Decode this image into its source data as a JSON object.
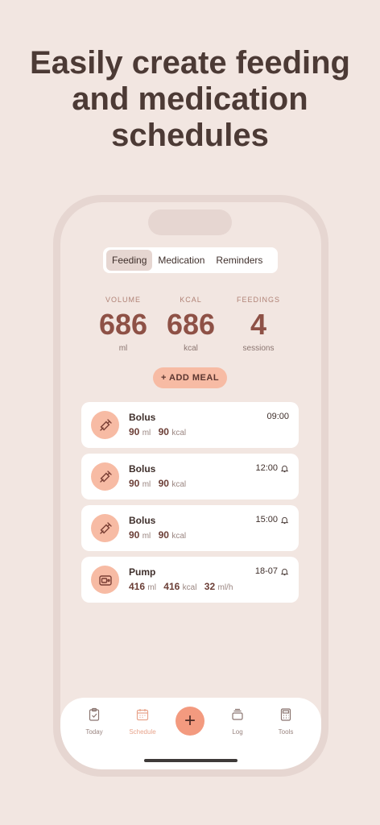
{
  "headline": {
    "line1": "Easily create feeding",
    "line2": "and medication",
    "line3": "schedules"
  },
  "tabs_segmented": [
    "Feeding",
    "Medication",
    "Reminders"
  ],
  "active_segment": "Feeding",
  "stats": [
    {
      "label": "VOLUME",
      "value": "686",
      "unit": "ml"
    },
    {
      "label": "KCAL",
      "value": "686",
      "unit": "kcal"
    },
    {
      "label": "FEEDINGS",
      "value": "4",
      "unit": "sessions"
    }
  ],
  "add_meal_label": "+ ADD MEAL",
  "meals": [
    {
      "name": "Bolus",
      "time": "09:00",
      "bell": false,
      "icon": "syringe-icon",
      "v1": "90",
      "u1": "ml",
      "v2": "90",
      "u2": "kcal",
      "v3": "",
      "u3": ""
    },
    {
      "name": "Bolus",
      "time": "12:00",
      "bell": true,
      "icon": "syringe-icon",
      "v1": "90",
      "u1": "ml",
      "v2": "90",
      "u2": "kcal",
      "v3": "",
      "u3": ""
    },
    {
      "name": "Bolus",
      "time": "15:00",
      "bell": true,
      "icon": "syringe-icon",
      "v1": "90",
      "u1": "ml",
      "v2": "90",
      "u2": "kcal",
      "v3": "",
      "u3": ""
    },
    {
      "name": "Pump",
      "time": "18-07",
      "bell": true,
      "icon": "pump-icon",
      "v1": "416",
      "u1": "ml",
      "v2": "416",
      "u2": "kcal",
      "v3": "32",
      "u3": "ml/h"
    }
  ],
  "tabbar": {
    "today": "Today",
    "schedule": "Schedule",
    "log": "Log",
    "tools": "Tools"
  },
  "colors": {
    "background": "#f2e6e1",
    "accent": "#f7bba4",
    "stat_value": "#8e5146"
  }
}
